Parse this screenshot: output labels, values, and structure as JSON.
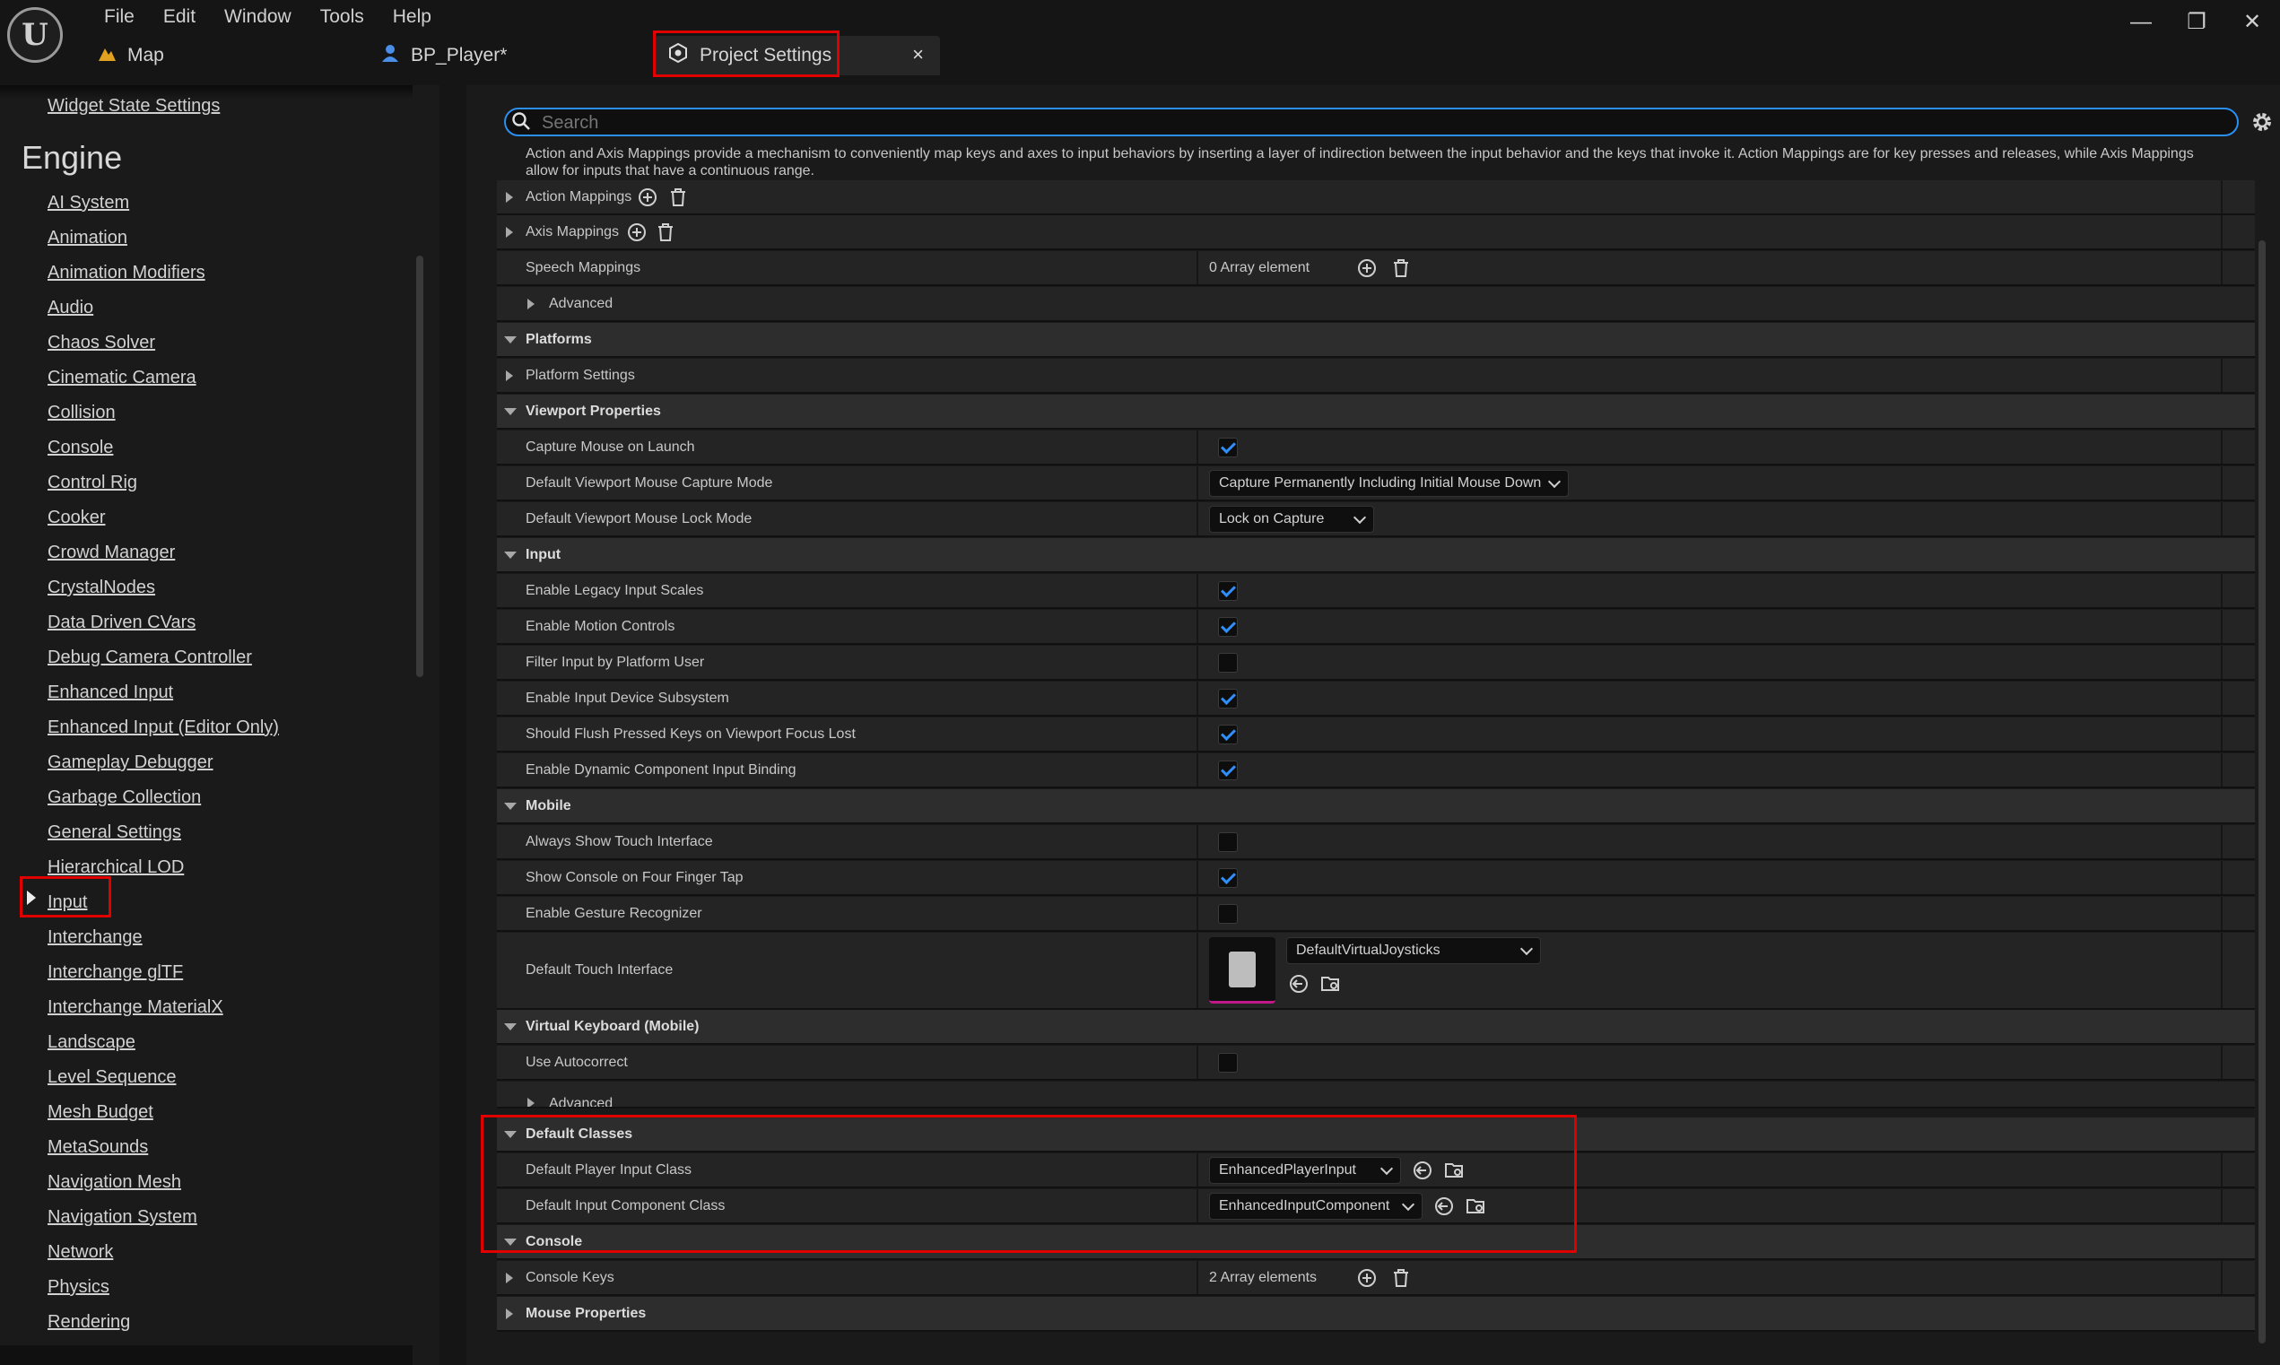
{
  "menu": [
    "File",
    "Edit",
    "Window",
    "Tools",
    "Help"
  ],
  "tabs": {
    "map": "Map",
    "bp_player": "BP_Player*",
    "project_settings": "Project Settings",
    "close": "×"
  },
  "window_controls": {
    "minimize": "—",
    "restore": "❐",
    "close": "✕"
  },
  "logo_letter": "U",
  "sidebar": {
    "top_item": "Widget State Settings",
    "section": "Engine",
    "items": [
      "AI System",
      "Animation",
      "Animation Modifiers",
      "Audio",
      "Chaos Solver",
      "Cinematic Camera",
      "Collision",
      "Console",
      "Control Rig",
      "Cooker",
      "Crowd Manager",
      "CrystalNodes",
      "Data Driven CVars",
      "Debug Camera Controller",
      "Enhanced Input",
      "Enhanced Input (Editor Only)",
      "Gameplay Debugger",
      "Garbage Collection",
      "General Settings",
      "Hierarchical LOD",
      "Input",
      "Interchange",
      "Interchange glTF",
      "Interchange MaterialX",
      "Landscape",
      "Level Sequence",
      "Mesh Budget",
      "MetaSounds",
      "Navigation Mesh",
      "Navigation System",
      "Network",
      "Physics",
      "Rendering"
    ]
  },
  "search": {
    "placeholder": "Search"
  },
  "description": "Action and Axis Mappings provide a mechanism to conveniently map keys and axes to input behaviors by inserting a layer of indirection between the input behavior and the keys that invoke it. Action Mappings are for key presses and releases, while Axis Mappings allow for inputs that have a continuous range.",
  "rows": {
    "action_mappings": "Action Mappings",
    "axis_mappings": "Axis Mappings",
    "speech_mappings": "Speech Mappings",
    "speech_value": "0 Array element",
    "advanced": "Advanced",
    "platforms": "Platforms",
    "platform_settings": "Platform Settings",
    "viewport_properties": "Viewport Properties",
    "capture_mouse": "Capture Mouse on Launch",
    "capture_mode": "Default Viewport Mouse Capture Mode",
    "capture_mode_value": "Capture Permanently Including Initial Mouse Down",
    "lock_mode": "Default Viewport Mouse Lock Mode",
    "lock_mode_value": "Lock on Capture",
    "input": "Input",
    "legacy_scales": "Enable Legacy Input Scales",
    "motion_controls": "Enable Motion Controls",
    "filter_platform_user": "Filter Input by Platform User",
    "device_subsystem": "Enable Input Device Subsystem",
    "flush_keys": "Should Flush Pressed Keys on Viewport Focus Lost",
    "dynamic_binding": "Enable Dynamic Component Input Binding",
    "mobile": "Mobile",
    "always_touch": "Always Show Touch Interface",
    "console_four_finger": "Show Console on Four Finger Tap",
    "gesture": "Enable Gesture Recognizer",
    "touch_interface": "Default Touch Interface",
    "touch_interface_value": "DefaultVirtualJoysticks",
    "virtual_keyboard": "Virtual Keyboard (Mobile)",
    "autocorrect": "Use Autocorrect",
    "default_classes": "Default Classes",
    "player_input_class": "Default Player Input Class",
    "player_input_value": "EnhancedPlayerInput",
    "input_component_class": "Default Input Component Class",
    "input_component_value": "EnhancedInputComponent",
    "console": "Console",
    "console_keys": "Console Keys",
    "console_keys_value": "2 Array elements",
    "mouse_properties": "Mouse Properties"
  },
  "checks": {
    "capture_mouse": true,
    "legacy_scales": true,
    "motion_controls": true,
    "filter_platform_user": false,
    "device_subsystem": true,
    "flush_keys": true,
    "dynamic_binding": true,
    "always_touch": false,
    "console_four_finger": true,
    "gesture": false,
    "autocorrect": false
  },
  "colors": {
    "accent": "#2f8ff8",
    "highlight_box": "#e00000",
    "map_icon": "#e0a020",
    "bp_icon": "#4a8ee8"
  }
}
